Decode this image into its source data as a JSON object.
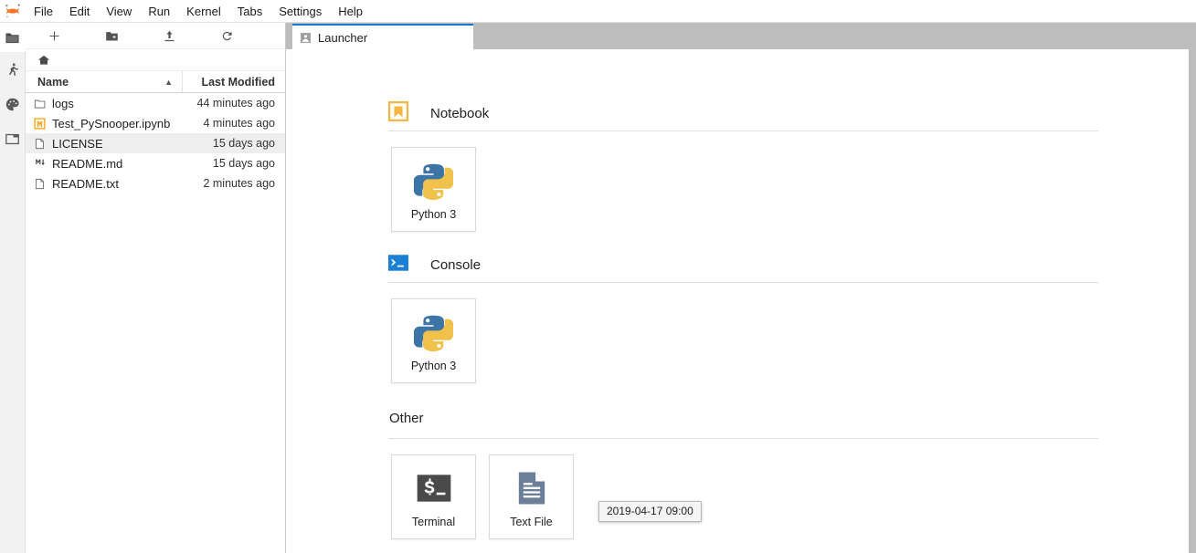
{
  "app": {
    "logo_icon": "jupyter-logo",
    "brand_color": "#f37726"
  },
  "menubar": {
    "items": [
      {
        "label": "File"
      },
      {
        "label": "Edit"
      },
      {
        "label": "View"
      },
      {
        "label": "Run"
      },
      {
        "label": "Kernel"
      },
      {
        "label": "Tabs"
      },
      {
        "label": "Settings"
      },
      {
        "label": "Help"
      }
    ]
  },
  "activitybar": {
    "items": [
      {
        "icon": "folder-icon",
        "name": "file-browser",
        "active": true
      },
      {
        "icon": "runner-icon",
        "name": "running-sessions",
        "active": false
      },
      {
        "icon": "palette-icon",
        "name": "command-palette",
        "active": false
      },
      {
        "icon": "tabs-icon",
        "name": "open-tabs",
        "active": false
      }
    ]
  },
  "filebrowser": {
    "toolbar": [
      {
        "icon": "plus-icon",
        "name": "new-launcher"
      },
      {
        "icon": "new-folder-icon",
        "name": "new-folder"
      },
      {
        "icon": "upload-icon",
        "name": "upload-files"
      },
      {
        "icon": "refresh-icon",
        "name": "refresh-list"
      }
    ],
    "breadcrumb": {
      "home_icon": "home-icon"
    },
    "columns": {
      "name": "Name",
      "sort_caret": "▲",
      "last_modified": "Last Modified"
    },
    "rows": [
      {
        "name": "logs",
        "modified": "44 minutes ago",
        "icon": "folder-icon",
        "selected": false
      },
      {
        "name": "Test_PySnooper.ipynb",
        "modified": "4 minutes ago",
        "icon": "notebook-icon",
        "selected": false
      },
      {
        "name": "LICENSE",
        "modified": "15 days ago",
        "icon": "file-icon",
        "selected": true
      },
      {
        "name": "README.md",
        "modified": "15 days ago",
        "icon": "markdown-icon",
        "selected": false
      },
      {
        "name": "README.txt",
        "modified": "2 minutes ago",
        "icon": "file-icon",
        "selected": false
      }
    ]
  },
  "dock": {
    "tabs": [
      {
        "label": "Launcher",
        "icon": "launcher-icon",
        "active": true
      }
    ]
  },
  "launcher": {
    "sections": [
      {
        "title": "Notebook",
        "icon": "notebook-section-icon",
        "cards": [
          {
            "label": "Python 3",
            "icon": "python-logo"
          }
        ]
      },
      {
        "title": "Console",
        "icon": "console-section-icon",
        "cards": [
          {
            "label": "Python 3",
            "icon": "python-logo"
          }
        ]
      },
      {
        "title": "Other",
        "icon": "",
        "cards": [
          {
            "label": "Terminal",
            "icon": "terminal-icon"
          },
          {
            "label": "Text File",
            "icon": "text-file-icon"
          }
        ]
      }
    ]
  },
  "tooltip": {
    "text": "2019-04-17 09:00"
  }
}
